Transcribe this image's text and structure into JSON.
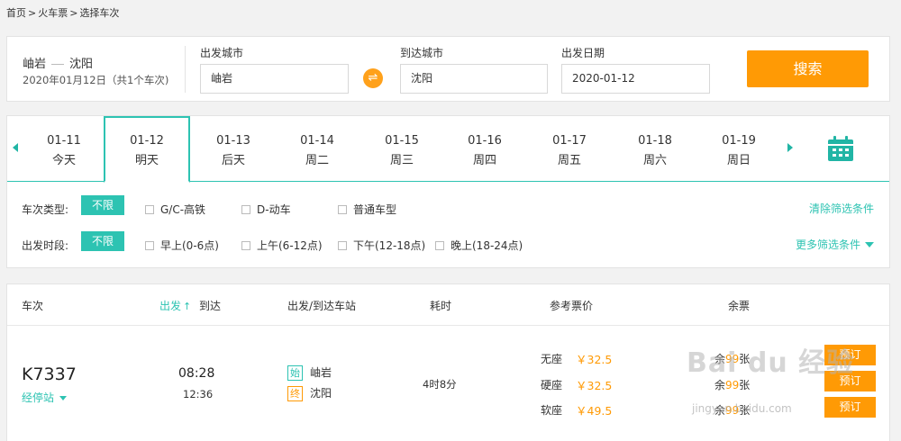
{
  "breadcrumb": [
    "首页",
    ">",
    "火车票",
    ">",
    "选择车次"
  ],
  "search": {
    "route_from": "岫岩",
    "route_to": "沈阳",
    "route_sub": "2020年01月12日（共1个车次)",
    "from_label": "出发城市",
    "from_value": "岫岩",
    "to_label": "到达城市",
    "to_value": "沈阳",
    "date_label": "出发日期",
    "date_value": "2020-01-12",
    "swap_icon": "⇌",
    "button": "搜索"
  },
  "dates": [
    {
      "date": "01-11",
      "day": "今天"
    },
    {
      "date": "01-12",
      "day": "明天",
      "active": true
    },
    {
      "date": "01-13",
      "day": "后天"
    },
    {
      "date": "01-14",
      "day": "周二"
    },
    {
      "date": "01-15",
      "day": "周三"
    },
    {
      "date": "01-16",
      "day": "周四"
    },
    {
      "date": "01-17",
      "day": "周五"
    },
    {
      "date": "01-18",
      "day": "周六"
    },
    {
      "date": "01-19",
      "day": "周日"
    }
  ],
  "filters": {
    "type_label": "车次类型:",
    "type_all": "不限",
    "type_options": [
      "G/C-高铁",
      "D-动车",
      "普通车型"
    ],
    "clear": "清除筛选条件",
    "time_label": "出发时段:",
    "time_all": "不限",
    "time_options": [
      "早上(0-6点)",
      "上午(6-12点)",
      "下午(12-18点)",
      "晚上(18-24点)"
    ],
    "more": "更多筛选条件"
  },
  "table": {
    "headers": {
      "train": "车次",
      "depart": "出发",
      "arrive": "到达",
      "stations": "出发/到达车站",
      "duration": "耗时",
      "price": "参考票价",
      "remaining": "余票"
    },
    "row": {
      "train_no": "K7337",
      "stops": "经停站",
      "depart_time": "08:28",
      "arrive_time": "12:36",
      "start_tag": "始",
      "from_station": "岫岩",
      "end_tag": "终",
      "to_station": "沈阳",
      "duration": "4时8分",
      "seats": [
        {
          "name": "无座",
          "price": "￥32.5",
          "pre": "余",
          "count": "99",
          "unit": "张",
          "book": "预订"
        },
        {
          "name": "硬座",
          "price": "￥32.5",
          "pre": "余",
          "count": "99",
          "unit": "张",
          "book": "预订"
        },
        {
          "name": "软座",
          "price": "￥49.5",
          "pre": "余",
          "count": "99",
          "unit": "张",
          "book": "预订"
        }
      ]
    }
  },
  "watermark": {
    "main": "Bai du 经验",
    "url": "jingyan.baidu.com"
  },
  "colors": {
    "accent": "#2dc3b2",
    "orange": "#ff9a05"
  }
}
